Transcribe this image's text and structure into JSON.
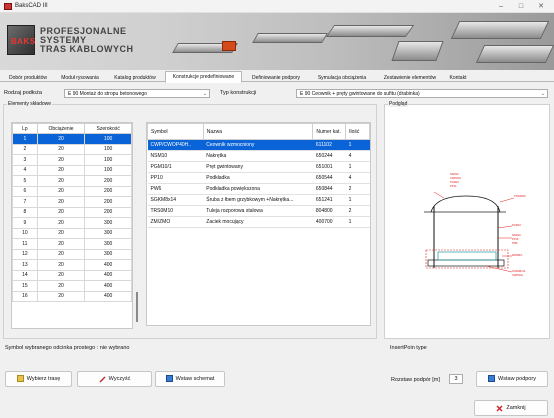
{
  "window": {
    "title": "BaksCAD III"
  },
  "banner": {
    "logo_text": "BAKS",
    "brand_line1": "PROFESJONALNE",
    "brand_line2": "SYSTEMY",
    "brand_line3": "TRAS KABLOWYCH"
  },
  "tabs": [
    "Dobór produktów",
    "Moduł rysowania",
    "Katalog produktów",
    "Konstrukcje predefiniowane",
    "Definiowanie podpory",
    "Symulacja obciążenia",
    "Zestawienie elementów",
    "Kontakt"
  ],
  "active_tab": "Konstrukcje predefiniowane",
  "toolbar": {
    "rodzaj_label": "Rodzaj podłoża",
    "rodzaj_value": "E 90 Montaż do stropu betonowego",
    "typ_label": "Typ konstrukcji",
    "typ_value": "E 90 Ceownik + pręty gwintowane do sufitu (drabinka)"
  },
  "elements_group": {
    "title": "Elementy składowe",
    "left_table": {
      "headers": [
        "Lp",
        "Obciążenie",
        "Szerokość"
      ],
      "rows": [
        [
          "1",
          "20",
          "100"
        ],
        [
          "2",
          "20",
          "100"
        ],
        [
          "3",
          "20",
          "100"
        ],
        [
          "4",
          "20",
          "100"
        ],
        [
          "5",
          "20",
          "200"
        ],
        [
          "6",
          "20",
          "200"
        ],
        [
          "7",
          "20",
          "200"
        ],
        [
          "8",
          "20",
          "200"
        ],
        [
          "9",
          "20",
          "300"
        ],
        [
          "10",
          "20",
          "300"
        ],
        [
          "11",
          "20",
          "300"
        ],
        [
          "12",
          "20",
          "300"
        ],
        [
          "13",
          "20",
          "400"
        ],
        [
          "14",
          "20",
          "400"
        ],
        [
          "15",
          "20",
          "400"
        ],
        [
          "16",
          "20",
          "400"
        ]
      ]
    },
    "right_table": {
      "headers": [
        "Symbol",
        "Nazwa",
        "Numer kat.",
        "Ilość"
      ],
      "rows": [
        [
          "CWP/CWOP40H..",
          "Ceownik wzmocniony",
          "611102",
          "1"
        ],
        [
          "NSM10",
          "Nakrętka",
          "650244",
          "4"
        ],
        [
          "PGM10/1",
          "Pręt gwintowany",
          "651001",
          "1"
        ],
        [
          "PP10",
          "Podkładka",
          "650544",
          "4"
        ],
        [
          "PW6",
          "Podkładka powiększona",
          "650844",
          "2"
        ],
        [
          "SGKM8x14",
          "Śruba z łbem grzybkowym +Nakrętka...",
          "651241",
          "1"
        ],
        [
          "TRS0M10",
          "Tuleja rozporowa stalowa",
          "804800",
          "2"
        ],
        [
          "ZM/ZMO",
          "Zaciek mocujący",
          "400700",
          "1"
        ]
      ]
    }
  },
  "preview": {
    "title": "Podgląd"
  },
  "bottom": {
    "symbol_label": "Symbol wybranego odcinka prostego :",
    "symbol_value": "nie wybrano",
    "insert_label": "InsertPoin type",
    "rozstaw_label": "Rozstaw podpór [m]",
    "rozstaw_value": "3",
    "btn_wybierz": "Wybierz trasę",
    "btn_wyczysc": "Wyczyść",
    "btn_wstaw_schemat": "Wstaw schemat",
    "btn_wstaw_podpory": "Wstaw podpory",
    "btn_zamknij": "Zamknij"
  },
  "colors": {
    "selection": "#0a64d8",
    "accent_red": "#e02020"
  }
}
